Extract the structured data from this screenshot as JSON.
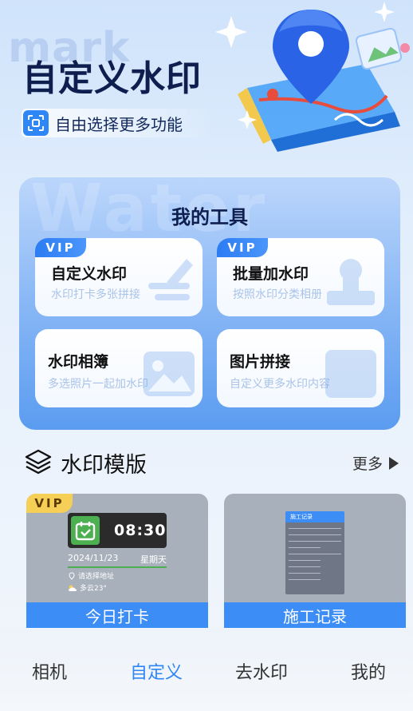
{
  "hero": {
    "bg_word": "mark",
    "title": "自定义水印",
    "subtitle": "自由选择更多功能",
    "icon": "scan-frame-icon"
  },
  "tools": {
    "bg_word": "Water",
    "title": "我的工具",
    "items": [
      {
        "name": "自定义水印",
        "desc": "水印打卡多张拼接",
        "badge": "VIP",
        "icon": "pencil-note-icon"
      },
      {
        "name": "批量加水印",
        "desc": "按照水印分类相册",
        "badge": "VIP",
        "icon": "stamp-icon"
      },
      {
        "name": "水印相簿",
        "desc": "多选照片一起加水印",
        "icon": "photo-album-icon"
      },
      {
        "name": "图片拼接",
        "desc": "自定义更多水印内容",
        "icon": "collage-icon"
      }
    ]
  },
  "templates": {
    "title": "水印模版",
    "icon": "layers-icon",
    "more": "更多",
    "items": [
      {
        "label": "今日打卡",
        "badge": "VIP",
        "time": "08:30",
        "date": "2024/11/23",
        "weekday": "星期天",
        "address": "请选择地址",
        "weather": "多云23°"
      },
      {
        "label": "施工记录",
        "header": "施工记录"
      }
    ]
  },
  "tabbar": {
    "items": [
      {
        "label": "相机"
      },
      {
        "label": "自定义"
      },
      {
        "label": "去水印"
      },
      {
        "label": "我的"
      }
    ],
    "active_index": 1,
    "active_color": "#2f86f6"
  },
  "colors": {
    "accent": "#2f86f6",
    "title_dark": "#0d1e4f",
    "vip_gold": "#f6cf57"
  }
}
